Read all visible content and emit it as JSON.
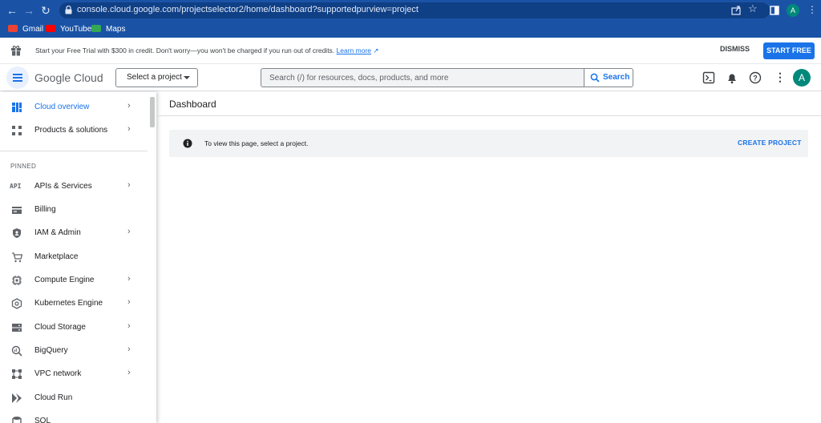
{
  "browser": {
    "url": "console.cloud.google.com/projectselector2/home/dashboard?supportedpurview=project",
    "profile_initial": "A",
    "bookmarks": [
      {
        "label": "Gmail",
        "icon": "gmail-icon",
        "color": "#ea4335"
      },
      {
        "label": "YouTube",
        "icon": "youtube-icon",
        "color": "#ff0000"
      },
      {
        "label": "Maps",
        "icon": "maps-icon",
        "color": "#34a853"
      }
    ]
  },
  "promo": {
    "text": "Start your Free Trial with $300 in credit. Don't worry—you won't be charged if you run out of credits.",
    "link": "Learn more",
    "dismiss": "DISMISS",
    "start": "START FREE"
  },
  "header": {
    "logo_google": "Google",
    "logo_cloud": "Cloud",
    "project_selector": "Select a project",
    "search_placeholder": "Search (/) for resources, docs, products, and more",
    "search_button": "Search",
    "avatar_initial": "A"
  },
  "sidebar": {
    "top_items": [
      {
        "label": "Cloud overview",
        "icon": "dashboard-icon",
        "chevron": true,
        "active": true
      },
      {
        "label": "Products & solutions",
        "icon": "grid-icon",
        "chevron": true
      }
    ],
    "pinned_label": "PINNED",
    "pinned_items": [
      {
        "label": "APIs & Services",
        "icon": "api-icon",
        "chevron": true
      },
      {
        "label": "Billing",
        "icon": "billing-icon",
        "chevron": false
      },
      {
        "label": "IAM & Admin",
        "icon": "shield-icon",
        "chevron": true
      },
      {
        "label": "Marketplace",
        "icon": "cart-icon",
        "chevron": false
      },
      {
        "label": "Compute Engine",
        "icon": "chip-icon",
        "chevron": true
      },
      {
        "label": "Kubernetes Engine",
        "icon": "kubernetes-icon",
        "chevron": true
      },
      {
        "label": "Cloud Storage",
        "icon": "storage-icon",
        "chevron": true
      },
      {
        "label": "BigQuery",
        "icon": "bigquery-icon",
        "chevron": true
      },
      {
        "label": "VPC network",
        "icon": "network-icon",
        "chevron": true
      },
      {
        "label": "Cloud Run",
        "icon": "run-icon",
        "chevron": false
      },
      {
        "label": "SQL",
        "icon": "sql-icon",
        "chevron": false
      }
    ]
  },
  "main": {
    "title": "Dashboard",
    "info_text": "To view this page, select a project.",
    "create_project": "CREATE PROJECT"
  },
  "colors": {
    "accent": "#1a73e8",
    "browser_chrome": "#1a53a6",
    "avatar": "#00897b"
  }
}
